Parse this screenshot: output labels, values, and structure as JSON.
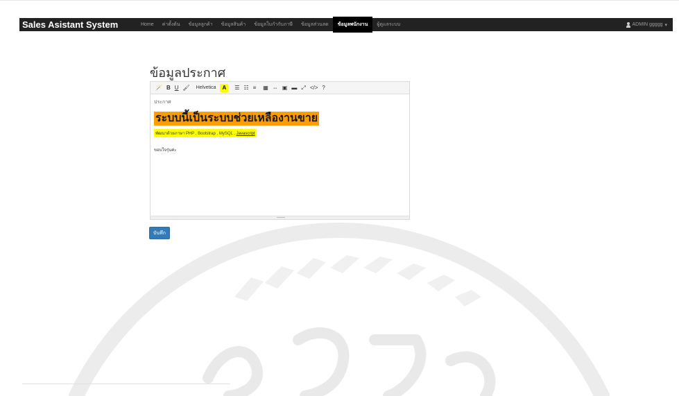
{
  "navbar": {
    "brand": "Sales Asistant System",
    "items": [
      {
        "label": "Home"
      },
      {
        "label": "ค่าตั้งต้น"
      },
      {
        "label": "ข้อมูลลูกค้า"
      },
      {
        "label": "ข้อมูลสินค้า"
      },
      {
        "label": "ข้อมูลใบกำกับภาษี"
      },
      {
        "label": "ข้อมูลส่วนลด"
      },
      {
        "label": "ข้อมูลพนักงาน"
      },
      {
        "label": "ผู้ดูแลระบบ"
      }
    ],
    "active_index": 6,
    "user_label": "ADMIN ggggg"
  },
  "page": {
    "title": "ข้อมูลประกาศ"
  },
  "editor": {
    "toolbar": {
      "magic": "🪄",
      "bold": "B",
      "underline": "U",
      "eraser": "🖌",
      "font_name": "Helvetica",
      "color": "A",
      "ul": "☰",
      "ol": "☷",
      "align": "≡",
      "table": "▦",
      "link": "⇔",
      "image": "▣",
      "video": "▬",
      "fullscreen": "⤢",
      "code": "</>",
      "help": "?"
    },
    "content": {
      "label": "ประกาศ",
      "heading": "ระบบนี้เป็นระบบช่วยเหลืองานขาย",
      "sub_prefix": "พัฒนาด้วยภาษา PHP , Bootstrap , MySQL ,",
      "sub_link": "Javascript",
      "thanks": "ขอบใจรุ่นค่ะ"
    }
  },
  "actions": {
    "save_label": "บันทึก"
  },
  "colors": {
    "navbar": "#222222",
    "primary": "#337ab7",
    "highlight_orange": "#ff9c00",
    "highlight_yellow": "#ffff00"
  }
}
